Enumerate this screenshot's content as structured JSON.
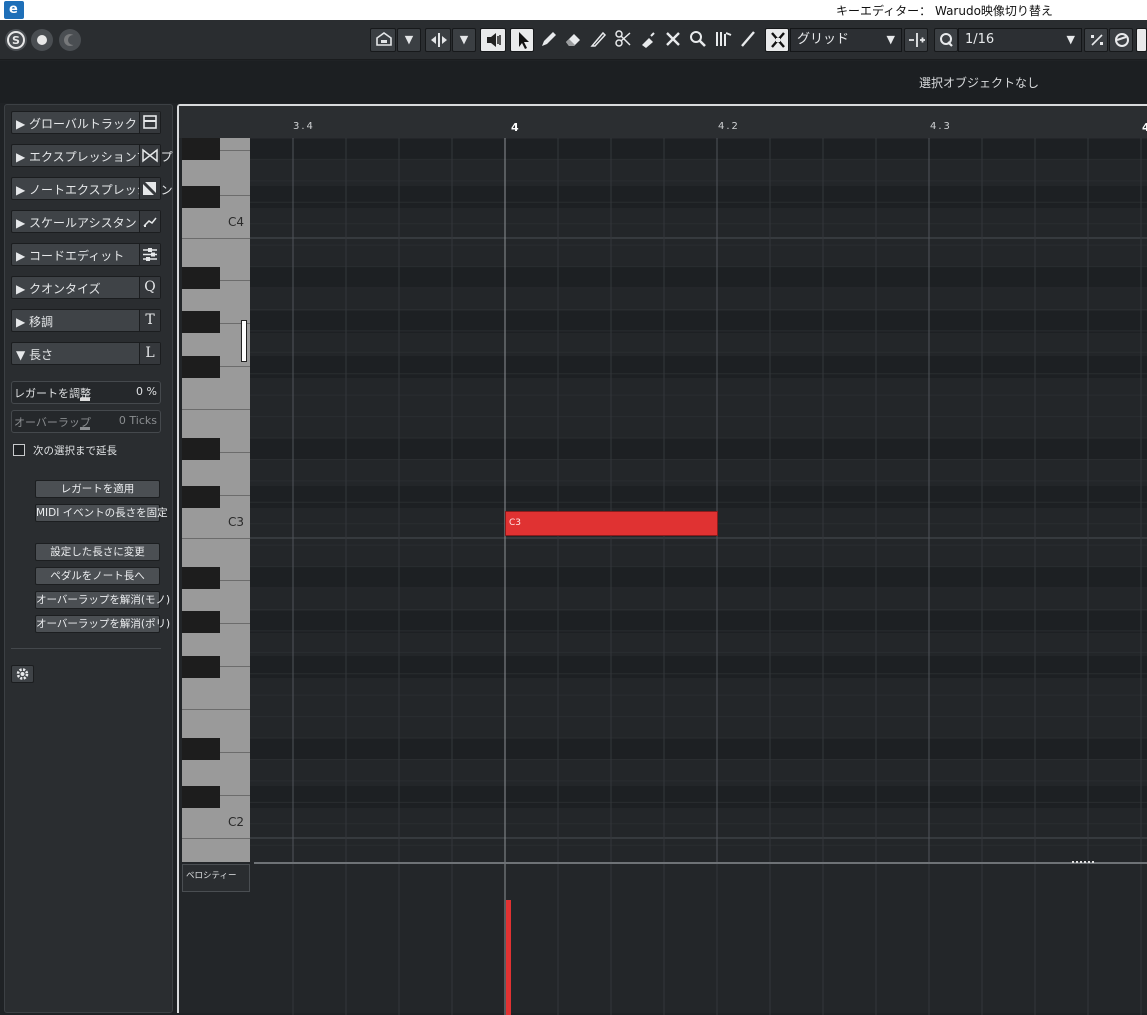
{
  "window": {
    "title": "キーエディター： Warudo映像切り替え",
    "app_icon": "cubase-logo-icon"
  },
  "toolbar": {
    "snap_type": "グリッド",
    "quantize": "1/16",
    "dropdown_arrow": "▼"
  },
  "info_line": {
    "text": "選択オブジェクトなし"
  },
  "inspector": {
    "sections": [
      {
        "label": "グローバルトラック",
        "icon": "track-panel-icon",
        "expanded": false
      },
      {
        "label": "エクスプレッションマップ",
        "icon": "bowtie-icon",
        "expanded": false
      },
      {
        "label": "ノートエクスプレッション",
        "icon": "diagonal-square-icon",
        "expanded": false
      },
      {
        "label": "スケールアシスタント",
        "icon": "scale-arrow-icon",
        "expanded": false
      },
      {
        "label": "コードエディット",
        "icon": "chord-sliders-icon",
        "expanded": false
      },
      {
        "label": "クオンタイズ",
        "icon": "Q",
        "expanded": false
      },
      {
        "label": "移調",
        "icon": "T",
        "expanded": false
      },
      {
        "label": "長さ",
        "icon": "L",
        "expanded": true
      }
    ],
    "expanded_glyph": "▼",
    "collapsed_glyph": "▶",
    "legato": {
      "label": "レガートを調整",
      "value": "0 %"
    },
    "overlap": {
      "label": "オーバーラップ",
      "value": "0 Ticks"
    },
    "extend_checkbox": {
      "label": "次の選択まで延長",
      "checked": false
    },
    "buttons_group1": [
      "レガートを適用",
      "MIDI イベントの長さを固定"
    ],
    "buttons_group2": [
      "設定した長さに変更",
      "ペダルをノート長へ",
      "オーバーラップを解消(モノ)",
      "オーバーラップを解消(ポリ)"
    ]
  },
  "editor": {
    "ruler_ticks": [
      {
        "label": "3.4",
        "major": false
      },
      {
        "label": "4",
        "major": true
      },
      {
        "label": "4.2",
        "major": false
      },
      {
        "label": "4.3",
        "major": false
      },
      {
        "label": "4",
        "major": true
      }
    ],
    "octave_labels": [
      "C4",
      "C3",
      "C2"
    ],
    "notes": [
      {
        "pitch": "C3",
        "label": "C3",
        "start": "4",
        "end": "4.2",
        "color": "#e03232"
      }
    ],
    "velocity_lane_label": "ベロシティー",
    "note_color": "#e03232"
  }
}
